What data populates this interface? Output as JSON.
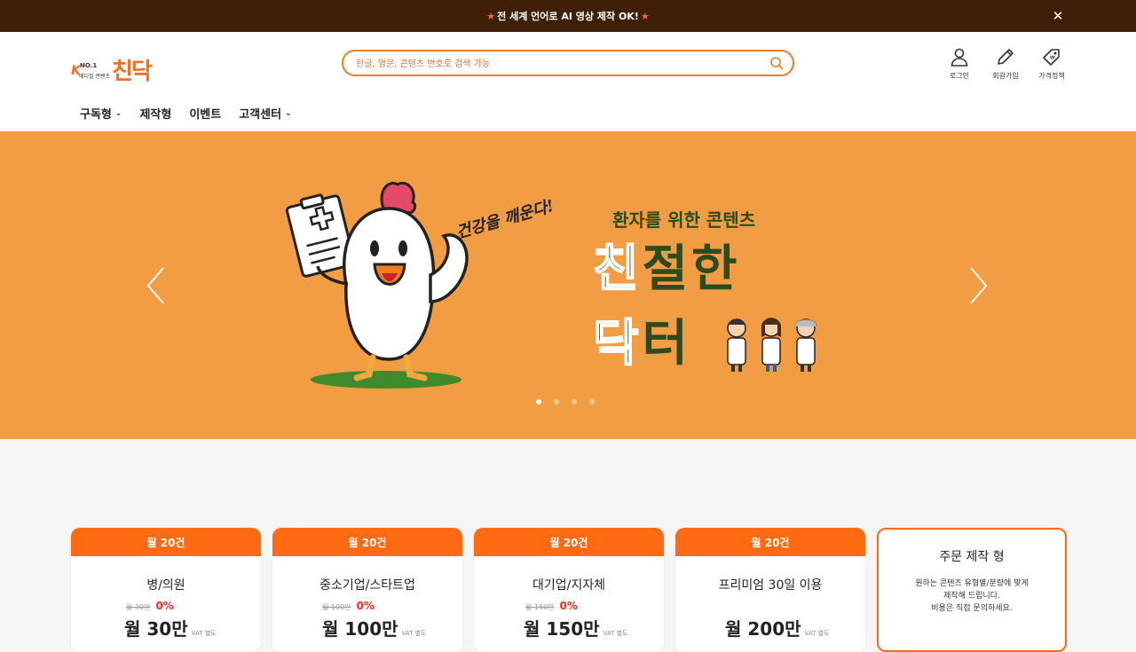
{
  "announcement": {
    "text": "전 세계 언어로 AI 영상 제작 OK!",
    "close": "✕"
  },
  "logo": {
    "k": "K",
    "no1": "NO.1",
    "small": "메디컬 콘텐츠",
    "mark": "친닥"
  },
  "search": {
    "placeholder": "한글, 영문, 콘텐츠 번호로 검색 가능"
  },
  "header_icons": [
    {
      "label": "로그인",
      "icon": "user-icon"
    },
    {
      "label": "회원가입",
      "icon": "pencil-icon"
    },
    {
      "label": "가격정책",
      "icon": "price-tag-icon"
    }
  ],
  "nav": [
    {
      "label": "구독형",
      "dropdown": true
    },
    {
      "label": "제작형",
      "dropdown": false
    },
    {
      "label": "이벤트",
      "dropdown": false
    },
    {
      "label": "고객센터",
      "dropdown": true
    }
  ],
  "hero": {
    "slogan": "건강을 깨운다!",
    "subtitle": "환자를 위한 콘텐츠",
    "line1_hl": "친",
    "line1_rest": "절한",
    "line2_hl": "닥",
    "line2_rest": "터",
    "active_slide": 1,
    "slide_count": 4,
    "bg_color": "#f29c43"
  },
  "cards": [
    {
      "head": "월 20건",
      "title": "병/의원",
      "old_price": "월 30만",
      "discount": "0%",
      "price": "월 30만",
      "vat": "VAT 별도"
    },
    {
      "head": "월 20건",
      "title": "중소기업/스타트업",
      "old_price": "월 100만",
      "discount": "0%",
      "price": "월 100만",
      "vat": "VAT 별도"
    },
    {
      "head": "월 20건",
      "title": "대기업/지자체",
      "old_price": "월 150만",
      "discount": "0%",
      "price": "월 150만",
      "vat": "VAT 별도"
    },
    {
      "head": "월 20건",
      "title": "프리미엄 30일 이용",
      "price": "월 200만",
      "vat": "VAT 별도"
    }
  ],
  "order_card": {
    "title": "주문 제작 형",
    "desc1": "원하는 콘텐츠 유형별/분량에 맞게",
    "desc2": "제작해 드립니다.",
    "desc3": "비용은 직접 문의하세요."
  },
  "colors": {
    "accent": "#ff6a13",
    "topbar": "#3f1f07",
    "hero_text": "#2d4b1e"
  }
}
